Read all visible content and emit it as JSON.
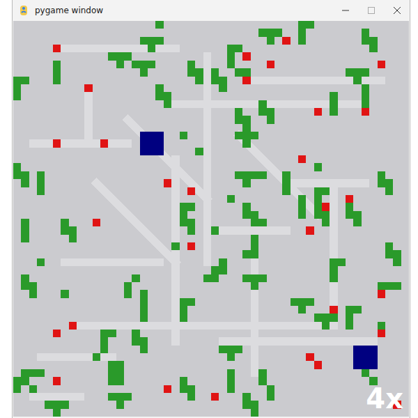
{
  "window": {
    "title": "pygame window"
  },
  "overlay": {
    "speed": "4x"
  },
  "board": {
    "cols": 50,
    "rows": 50,
    "trails": [
      [
        [
          6,
          3
        ],
        [
          20,
          3
        ]
      ],
      [
        [
          2,
          15
        ],
        [
          14,
          15
        ]
      ],
      [
        [
          20,
          10
        ],
        [
          44,
          10
        ]
      ],
      [
        [
          9,
          9
        ],
        [
          9,
          14
        ]
      ],
      [
        [
          20,
          17
        ],
        [
          20,
          40
        ]
      ],
      [
        [
          8,
          38
        ],
        [
          40,
          38
        ]
      ],
      [
        [
          26,
          40
        ],
        [
          45,
          40
        ]
      ],
      [
        [
          3,
          42
        ],
        [
          12,
          42
        ]
      ],
      [
        [
          40,
          20
        ],
        [
          40,
          37
        ]
      ],
      [
        [
          28,
          14
        ],
        [
          38,
          24
        ]
      ],
      [
        [
          10,
          20
        ],
        [
          20,
          30
        ]
      ],
      [
        [
          2,
          47
        ],
        [
          8,
          47
        ]
      ],
      [
        [
          30,
          7
        ],
        [
          46,
          7
        ]
      ],
      [
        [
          34,
          20
        ],
        [
          44,
          20
        ]
      ],
      [
        [
          24,
          26
        ],
        [
          34,
          26
        ]
      ],
      [
        [
          14,
          12
        ],
        [
          24,
          22
        ]
      ],
      [
        [
          24,
          4
        ],
        [
          24,
          30
        ]
      ],
      [
        [
          6,
          30
        ],
        [
          18,
          30
        ]
      ],
      [
        [
          30,
          30
        ],
        [
          30,
          44
        ]
      ]
    ],
    "obstacles": [
      [
        [
          18,
          0
        ]
      ],
      [
        [
          16,
          2
        ],
        [
          17,
          2
        ],
        [
          18,
          2
        ],
        [
          17,
          3
        ]
      ],
      [
        [
          31,
          1
        ],
        [
          32,
          1
        ],
        [
          33,
          1
        ],
        [
          32,
          2
        ]
      ],
      [
        [
          36,
          0
        ],
        [
          37,
          0
        ],
        [
          36,
          1
        ],
        [
          36,
          2
        ]
      ],
      [
        [
          44,
          1
        ],
        [
          44,
          2
        ],
        [
          45,
          2
        ],
        [
          45,
          3
        ]
      ],
      [
        [
          12,
          4
        ],
        [
          13,
          4
        ],
        [
          14,
          4
        ],
        [
          13,
          5
        ]
      ],
      [
        [
          15,
          5
        ],
        [
          16,
          5
        ],
        [
          17,
          5
        ],
        [
          16,
          6
        ]
      ],
      [
        [
          27,
          3
        ],
        [
          28,
          3
        ],
        [
          27,
          4
        ],
        [
          27,
          5
        ]
      ],
      [
        [
          0,
          7
        ],
        [
          1,
          7
        ],
        [
          0,
          8
        ],
        [
          0,
          9
        ]
      ],
      [
        [
          5,
          5
        ],
        [
          5,
          6
        ],
        [
          5,
          7
        ]
      ],
      [
        [
          22,
          5
        ],
        [
          22,
          6
        ],
        [
          23,
          6
        ],
        [
          23,
          7
        ]
      ],
      [
        [
          25,
          6
        ],
        [
          25,
          7
        ],
        [
          26,
          7
        ],
        [
          26,
          8
        ]
      ],
      [
        [
          28,
          6
        ],
        [
          29,
          6
        ]
      ],
      [
        [
          42,
          6
        ],
        [
          43,
          6
        ],
        [
          44,
          6
        ],
        [
          43,
          7
        ]
      ],
      [
        [
          44,
          8
        ],
        [
          44,
          9
        ],
        [
          44,
          10
        ]
      ],
      [
        [
          18,
          8
        ],
        [
          18,
          9
        ],
        [
          19,
          9
        ],
        [
          19,
          10
        ]
      ],
      [
        [
          31,
          10
        ],
        [
          31,
          11
        ],
        [
          32,
          11
        ],
        [
          32,
          12
        ]
      ],
      [
        [
          40,
          9
        ],
        [
          40,
          10
        ],
        [
          40,
          11
        ]
      ],
      [
        [
          28,
          11
        ],
        [
          28,
          12
        ],
        [
          29,
          12
        ],
        [
          29,
          13
        ]
      ],
      [
        [
          28,
          14
        ],
        [
          29,
          14
        ],
        [
          30,
          14
        ],
        [
          29,
          15
        ]
      ],
      [
        [
          21,
          14
        ]
      ],
      [
        [
          23,
          16
        ]
      ],
      [
        [
          38,
          18
        ]
      ],
      [
        [
          0,
          18
        ],
        [
          0,
          19
        ],
        [
          1,
          19
        ],
        [
          1,
          20
        ]
      ],
      [
        [
          3,
          19
        ],
        [
          3,
          20
        ],
        [
          3,
          21
        ]
      ],
      [
        [
          28,
          19
        ],
        [
          29,
          19
        ],
        [
          30,
          19
        ],
        [
          31,
          19
        ],
        [
          29,
          20
        ]
      ],
      [
        [
          34,
          19
        ],
        [
          34,
          20
        ],
        [
          34,
          21
        ]
      ],
      [
        [
          46,
          19
        ],
        [
          46,
          20
        ],
        [
          47,
          20
        ],
        [
          47,
          21
        ]
      ],
      [
        [
          27,
          22
        ]
      ],
      [
        [
          21,
          23
        ],
        [
          22,
          23
        ],
        [
          21,
          24
        ],
        [
          21,
          25
        ],
        [
          22,
          25
        ],
        [
          22,
          26
        ]
      ],
      [
        [
          29,
          23
        ],
        [
          29,
          24
        ],
        [
          30,
          24
        ],
        [
          30,
          25
        ]
      ],
      [
        [
          36,
          22
        ],
        [
          36,
          23
        ],
        [
          36,
          24
        ]
      ],
      [
        [
          38,
          21
        ],
        [
          39,
          21
        ],
        [
          38,
          22
        ],
        [
          38,
          23
        ],
        [
          38,
          24
        ],
        [
          39,
          24
        ],
        [
          39,
          25
        ]
      ],
      [
        [
          42,
          23
        ],
        [
          42,
          24
        ],
        [
          43,
          24
        ],
        [
          43,
          25
        ]
      ],
      [
        [
          1,
          25
        ],
        [
          1,
          26
        ],
        [
          1,
          27
        ]
      ],
      [
        [
          6,
          25
        ],
        [
          6,
          26
        ],
        [
          7,
          26
        ],
        [
          7,
          27
        ]
      ],
      [
        [
          25,
          26
        ]
      ],
      [
        [
          31,
          25
        ]
      ],
      [
        [
          20,
          28
        ]
      ],
      [
        [
          30,
          27
        ],
        [
          30,
          28
        ],
        [
          29,
          29
        ],
        [
          30,
          29
        ]
      ],
      [
        [
          47,
          28
        ],
        [
          47,
          29
        ],
        [
          48,
          29
        ],
        [
          48,
          30
        ]
      ],
      [
        [
          3,
          30
        ]
      ],
      [
        [
          26,
          30
        ],
        [
          25,
          31
        ],
        [
          26,
          31
        ],
        [
          24,
          32
        ],
        [
          25,
          32
        ]
      ],
      [
        [
          29,
          32
        ],
        [
          30,
          32
        ],
        [
          31,
          32
        ],
        [
          30,
          33
        ]
      ],
      [
        [
          41,
          30
        ],
        [
          40,
          30
        ],
        [
          40,
          31
        ],
        [
          40,
          32
        ]
      ],
      [
        [
          1,
          32
        ],
        [
          1,
          33
        ],
        [
          2,
          33
        ],
        [
          2,
          34
        ]
      ],
      [
        [
          15,
          32
        ],
        [
          14,
          33
        ],
        [
          14,
          34
        ]
      ],
      [
        [
          6,
          34
        ]
      ],
      [
        [
          16,
          34
        ],
        [
          16,
          35
        ],
        [
          16,
          36
        ],
        [
          16,
          37
        ]
      ],
      [
        [
          21,
          35
        ],
        [
          22,
          35
        ],
        [
          21,
          36
        ],
        [
          21,
          37
        ]
      ],
      [
        [
          35,
          35
        ],
        [
          36,
          35
        ],
        [
          37,
          35
        ],
        [
          36,
          36
        ]
      ],
      [
        [
          46,
          33
        ],
        [
          47,
          33
        ],
        [
          48,
          33
        ],
        [
          46,
          34
        ]
      ],
      [
        [
          38,
          37
        ],
        [
          39,
          37
        ],
        [
          40,
          37
        ],
        [
          39,
          38
        ]
      ],
      [
        [
          42,
          36
        ],
        [
          43,
          36
        ],
        [
          42,
          37
        ],
        [
          42,
          38
        ]
      ],
      [
        [
          11,
          39
        ],
        [
          12,
          39
        ],
        [
          11,
          40
        ],
        [
          11,
          41
        ]
      ],
      [
        [
          15,
          39
        ],
        [
          15,
          40
        ],
        [
          16,
          40
        ],
        [
          16,
          41
        ]
      ],
      [
        [
          46,
          38
        ]
      ],
      [
        [
          26,
          41
        ],
        [
          27,
          41
        ],
        [
          28,
          41
        ],
        [
          27,
          42
        ]
      ],
      [
        [
          12,
          43
        ],
        [
          13,
          43
        ],
        [
          12,
          44
        ],
        [
          13,
          44
        ],
        [
          12,
          45
        ],
        [
          13,
          45
        ]
      ],
      [
        [
          10,
          42
        ]
      ],
      [
        [
          1,
          44
        ],
        [
          2,
          44
        ],
        [
          3,
          44
        ],
        [
          1,
          45
        ],
        [
          2,
          46
        ]
      ],
      [
        [
          0,
          45
        ],
        [
          0,
          46
        ]
      ],
      [
        [
          27,
          44
        ],
        [
          27,
          45
        ],
        [
          27,
          46
        ]
      ],
      [
        [
          31,
          44
        ],
        [
          31,
          45
        ],
        [
          32,
          46
        ],
        [
          32,
          47
        ]
      ],
      [
        [
          21,
          45
        ],
        [
          21,
          46
        ],
        [
          22,
          46
        ],
        [
          22,
          47
        ]
      ],
      [
        [
          12,
          47
        ],
        [
          13,
          47
        ],
        [
          14,
          47
        ],
        [
          13,
          48
        ]
      ],
      [
        [
          4,
          48
        ],
        [
          5,
          48
        ],
        [
          6,
          48
        ],
        [
          5,
          49
        ]
      ],
      [
        [
          29,
          47
        ],
        [
          29,
          48
        ],
        [
          30,
          48
        ],
        [
          30,
          49
        ]
      ],
      [
        [
          44,
          44
        ],
        [
          45,
          45
        ]
      ]
    ],
    "food": [
      [
        5,
        3
      ],
      [
        9,
        8
      ],
      [
        5,
        15
      ],
      [
        11,
        15
      ],
      [
        34,
        2
      ],
      [
        29,
        4
      ],
      [
        32,
        5
      ],
      [
        29,
        7
      ],
      [
        46,
        5
      ],
      [
        38,
        11
      ],
      [
        44,
        11
      ],
      [
        36,
        17
      ],
      [
        19,
        20
      ],
      [
        22,
        21
      ],
      [
        39,
        23
      ],
      [
        42,
        22
      ],
      [
        10,
        25
      ],
      [
        37,
        26
      ],
      [
        22,
        28
      ],
      [
        46,
        34
      ],
      [
        40,
        36
      ],
      [
        7,
        38
      ],
      [
        5,
        39
      ],
      [
        46,
        39
      ],
      [
        37,
        42
      ],
      [
        38,
        43
      ],
      [
        5,
        45
      ],
      [
        19,
        46
      ],
      [
        25,
        47
      ],
      [
        48,
        48
      ]
    ],
    "agents": [
      {
        "cell": [
          16,
          14
        ],
        "size": 3
      },
      {
        "cell": [
          43,
          41
        ],
        "size": 3
      }
    ]
  }
}
